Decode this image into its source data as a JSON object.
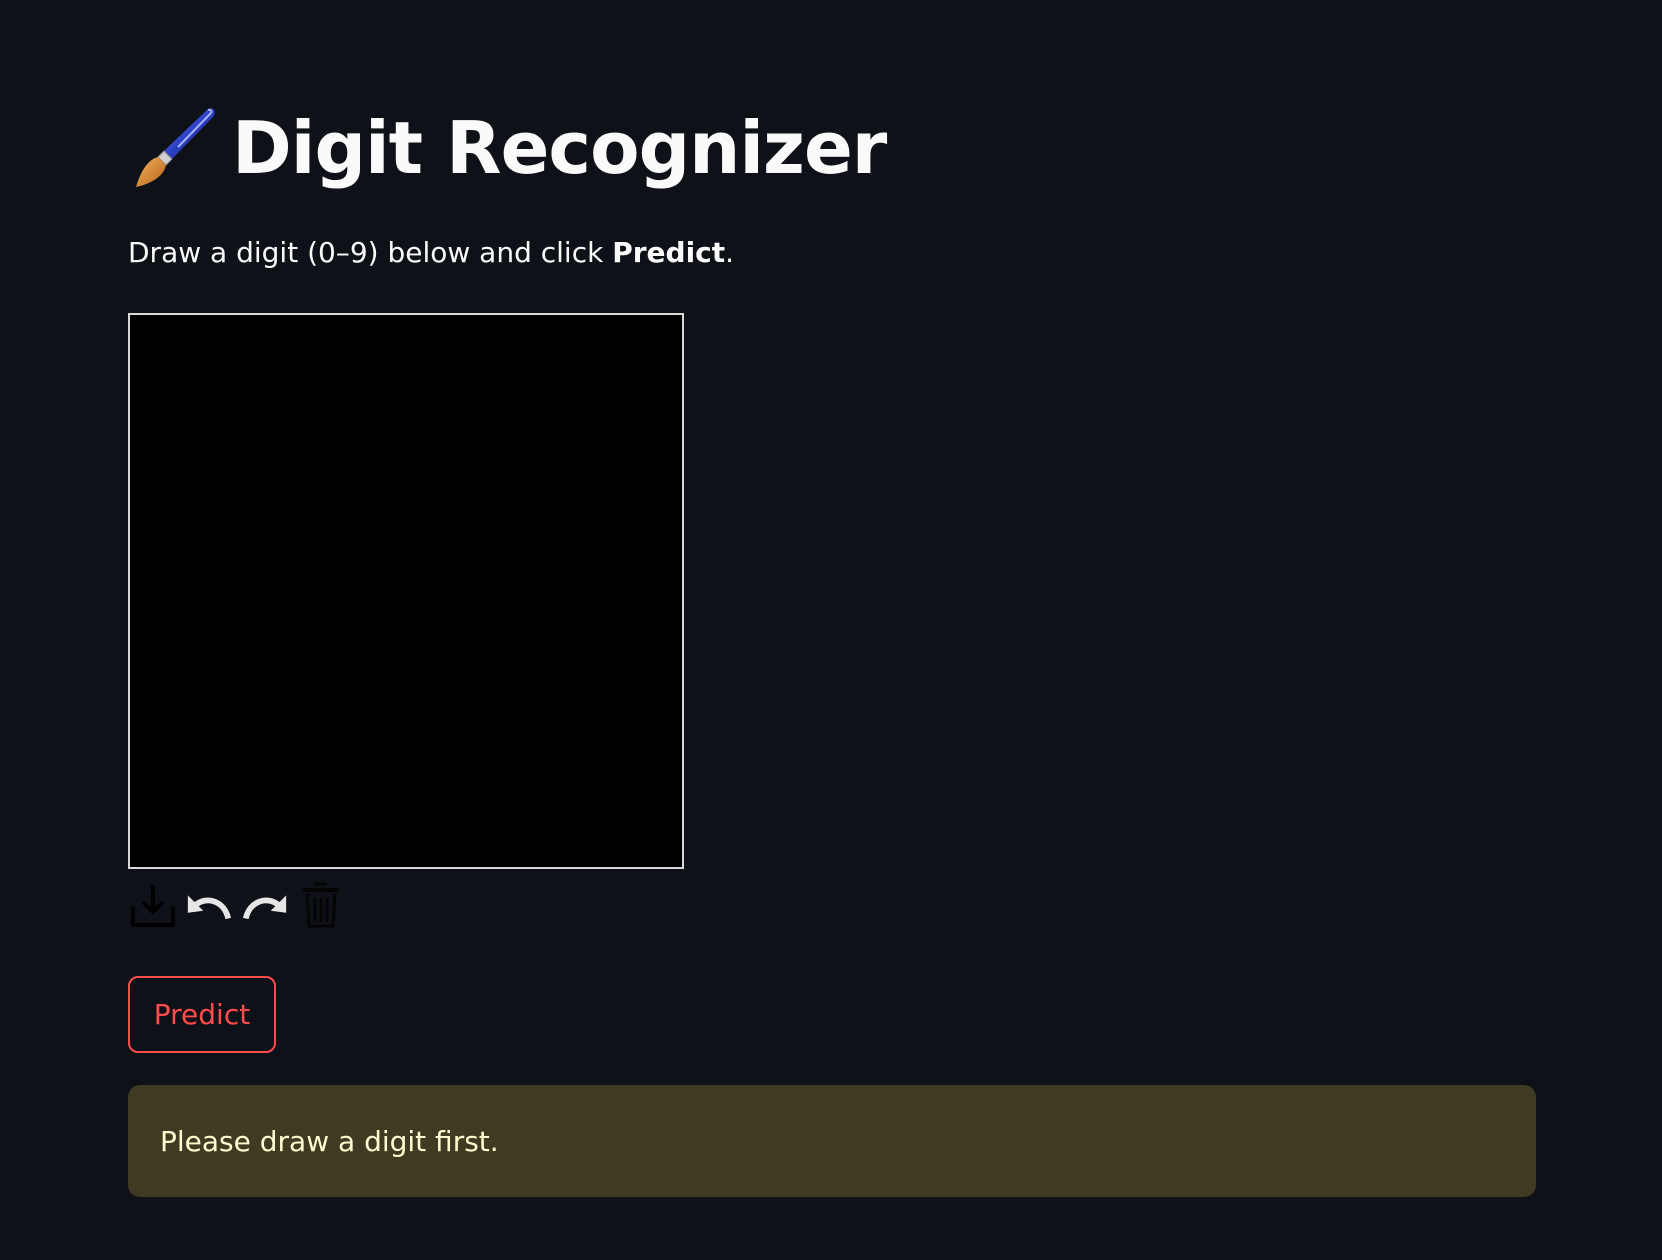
{
  "header": {
    "icon": "paintbrush-icon",
    "title": "Digit Recognizer"
  },
  "intro": {
    "text_before": "Draw a digit (0–9) below and click ",
    "bold": "Predict",
    "text_after": "."
  },
  "canvas": {
    "background": "#000000",
    "border_color": "#d9d9d9"
  },
  "toolbar": {
    "tools": [
      {
        "name": "download-icon"
      },
      {
        "name": "undo-icon"
      },
      {
        "name": "redo-icon"
      },
      {
        "name": "trash-icon"
      }
    ]
  },
  "actions": {
    "predict_label": "Predict",
    "accent": "#ff4b4b"
  },
  "alert": {
    "message": "Please draw a digit first.",
    "background": "#3e3b22",
    "text_color": "#fffbd0"
  },
  "colors": {
    "page_background": "#0e1117",
    "text": "#fafafa"
  }
}
